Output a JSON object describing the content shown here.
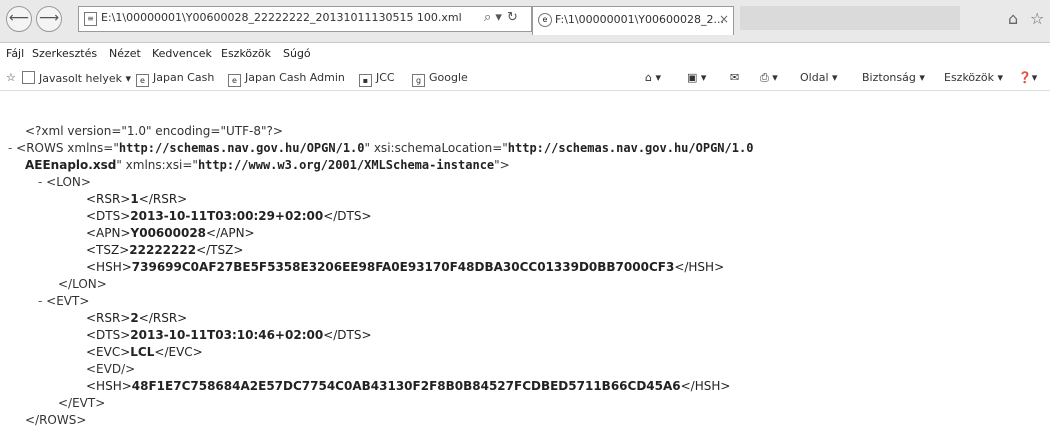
{
  "browser": {
    "address": "E:\\1\\00000001\\Y00600028_22222222_20131011130515 100.xml",
    "tab_title": "F:\\1\\00000001\\Y00600028_2...",
    "tab_close": "×"
  },
  "menu": [
    "Fájl",
    "Szerkesztés",
    "Nézet",
    "Kedvencek",
    "Eszközök",
    "Súgó"
  ],
  "favorites": [
    "Javasolt helyek ▾",
    "Japan Cash",
    "Japan Cash Admin",
    "JCC",
    "Google"
  ],
  "commands": {
    "page": "Oldal ▾",
    "safety": "Biztonság ▾",
    "tools": "Eszközök ▾"
  },
  "xml": {
    "decl": "<?xml version=\"1.0\" encoding=\"UTF-8\"?>",
    "rows_open_a": "<ROWS xmlns=\"",
    "rows_ns": "http://schemas.nav.gov.hu/OPGN/1.0",
    "rows_open_b": "\" xsi:schemaLocation=\"",
    "rows_schema_a": "http://schemas.nav.gov.hu/OPGN/1.0",
    "rows_schema_b": "AEEnaplo.xsd",
    "rows_open_c": "\" xmlns:xsi=\"",
    "rows_xsi": "http://www.w3.org/2001/XMLSchema-instance",
    "rows_open_d": "\">",
    "lon_open": "<LON>",
    "lon": {
      "rsr": "1",
      "dts": "2013-10-11T03:00:29+02:00",
      "apn": "Y00600028",
      "tsz": "22222222",
      "hsh": "739699C0AF27BE5F5358E3206EE98FA0E93170F48DBA30CC01339D0BB7000CF3"
    },
    "lon_close": "</LON>",
    "evt_open": "<EVT>",
    "evt": {
      "rsr": "2",
      "dts": "2013-10-11T03:10:46+02:00",
      "evc": "LCL",
      "evd": "<EVD/>",
      "hsh": "48F1E7C758684A2E57DC7754C0AB43130F2F8B0B84527FCDBED5711B66CD45A6"
    },
    "evt_close": "</EVT>",
    "rows_close": "</ROWS>"
  }
}
